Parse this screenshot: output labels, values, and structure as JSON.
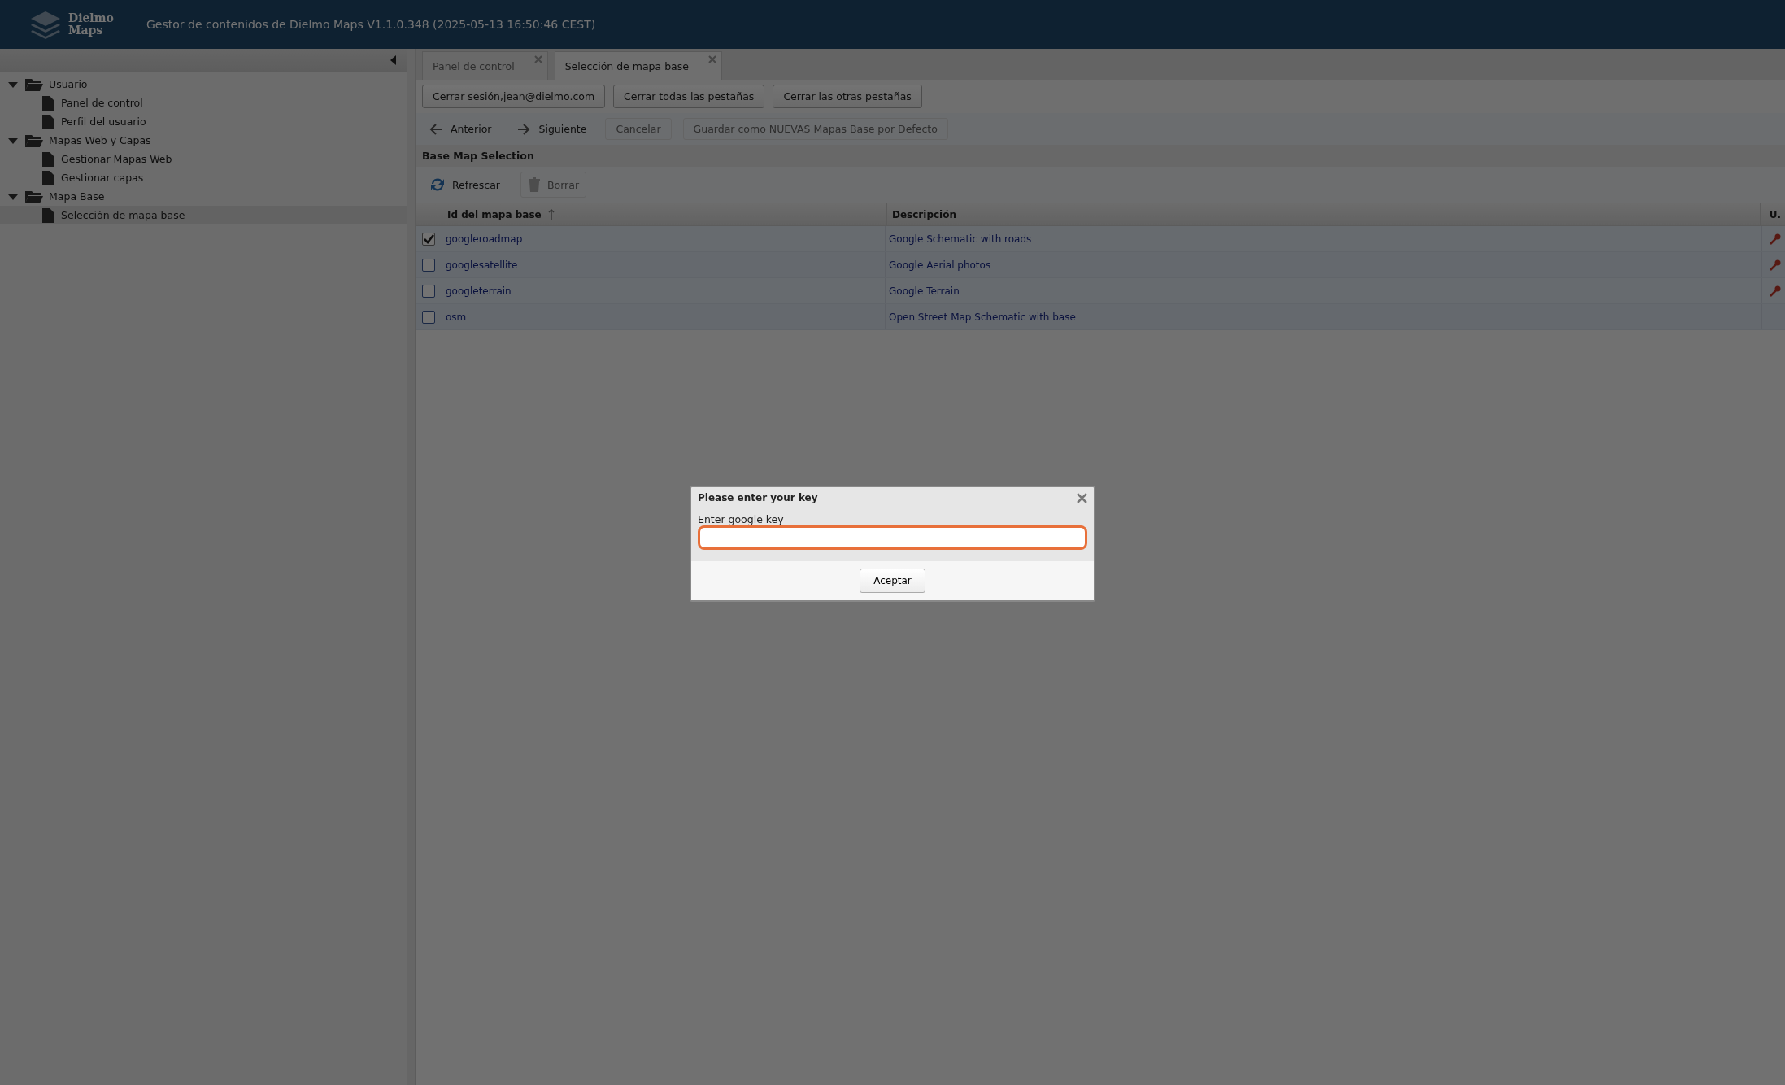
{
  "header": {
    "logo": [
      "Dielmo",
      "Maps"
    ],
    "title": "Gestor de contenidos de Dielmo Maps V1.1.0.348 (2025-05-13 16:50:46 CEST)"
  },
  "sidebar": {
    "tree": [
      {
        "label": "Usuario",
        "expanded": true,
        "children": [
          {
            "label": "Panel de control",
            "selected": false
          },
          {
            "label": "Perfil del usuario",
            "selected": false
          }
        ]
      },
      {
        "label": "Mapas Web y Capas",
        "expanded": true,
        "children": [
          {
            "label": "Gestionar Mapas Web",
            "selected": false
          },
          {
            "label": "Gestionar capas",
            "selected": false
          }
        ]
      },
      {
        "label": "Mapa Base",
        "expanded": true,
        "children": [
          {
            "label": "Selección de mapa base",
            "selected": true
          }
        ]
      }
    ]
  },
  "tabs": [
    {
      "label": "Panel de control",
      "selected": false
    },
    {
      "label": "Selección de mapa base",
      "selected": true
    }
  ],
  "session_buttons": [
    "Cerrar sesión,jean@dielmo.com",
    "Cerrar todas las pestañas",
    "Cerrar las otras pestañas"
  ],
  "nav_toolbar": [
    {
      "label": "Anterior",
      "kind": "back",
      "disabled": false
    },
    {
      "label": "Siguiente",
      "kind": "forward",
      "disabled": false
    },
    {
      "label": "Cancelar",
      "kind": "plain",
      "disabled": true
    },
    {
      "label": "Guardar como NUEVAS Mapas Base por Defecto",
      "kind": "plain",
      "disabled": true
    }
  ],
  "panel_title": "Base Map Selection",
  "grid_toolbar": [
    {
      "label": "Refrescar",
      "kind": "refresh",
      "disabled": false
    },
    {
      "label": "Borrar",
      "kind": "delete",
      "disabled": true
    }
  ],
  "table": {
    "columns": [
      {
        "label": "Id del mapa base",
        "sorted": true
      },
      {
        "label": "Descripción",
        "sorted": false
      },
      {
        "label": "U.",
        "sorted": false
      }
    ],
    "rows": [
      {
        "id": "googleroadmap",
        "description": "Google Schematic with roads",
        "checked": true,
        "key": true
      },
      {
        "id": "googlesatellite",
        "description": "Google Aerial photos",
        "checked": false,
        "key": true
      },
      {
        "id": "googleterrain",
        "description": "Google Terrain",
        "checked": false,
        "key": true
      },
      {
        "id": "osm",
        "description": "Open Street Map Schematic with base",
        "checked": false,
        "key": false
      }
    ]
  },
  "dialog": {
    "title": "Please enter your key",
    "label": "Enter google key",
    "button": "Aceptar"
  }
}
